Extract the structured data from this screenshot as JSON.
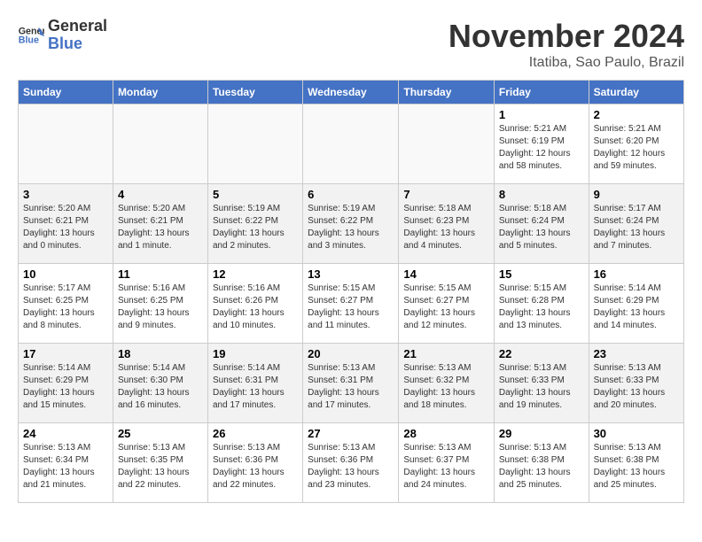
{
  "header": {
    "logo_general": "General",
    "logo_blue": "Blue",
    "month_year": "November 2024",
    "location": "Itatiba, Sao Paulo, Brazil"
  },
  "days_of_week": [
    "Sunday",
    "Monday",
    "Tuesday",
    "Wednesday",
    "Thursday",
    "Friday",
    "Saturday"
  ],
  "weeks": [
    {
      "days": [
        {
          "num": "",
          "info": ""
        },
        {
          "num": "",
          "info": ""
        },
        {
          "num": "",
          "info": ""
        },
        {
          "num": "",
          "info": ""
        },
        {
          "num": "",
          "info": ""
        },
        {
          "num": "1",
          "info": "Sunrise: 5:21 AM\nSunset: 6:19 PM\nDaylight: 12 hours and 58 minutes."
        },
        {
          "num": "2",
          "info": "Sunrise: 5:21 AM\nSunset: 6:20 PM\nDaylight: 12 hours and 59 minutes."
        }
      ]
    },
    {
      "days": [
        {
          "num": "3",
          "info": "Sunrise: 5:20 AM\nSunset: 6:21 PM\nDaylight: 13 hours and 0 minutes."
        },
        {
          "num": "4",
          "info": "Sunrise: 5:20 AM\nSunset: 6:21 PM\nDaylight: 13 hours and 1 minute."
        },
        {
          "num": "5",
          "info": "Sunrise: 5:19 AM\nSunset: 6:22 PM\nDaylight: 13 hours and 2 minutes."
        },
        {
          "num": "6",
          "info": "Sunrise: 5:19 AM\nSunset: 6:22 PM\nDaylight: 13 hours and 3 minutes."
        },
        {
          "num": "7",
          "info": "Sunrise: 5:18 AM\nSunset: 6:23 PM\nDaylight: 13 hours and 4 minutes."
        },
        {
          "num": "8",
          "info": "Sunrise: 5:18 AM\nSunset: 6:24 PM\nDaylight: 13 hours and 5 minutes."
        },
        {
          "num": "9",
          "info": "Sunrise: 5:17 AM\nSunset: 6:24 PM\nDaylight: 13 hours and 7 minutes."
        }
      ]
    },
    {
      "days": [
        {
          "num": "10",
          "info": "Sunrise: 5:17 AM\nSunset: 6:25 PM\nDaylight: 13 hours and 8 minutes."
        },
        {
          "num": "11",
          "info": "Sunrise: 5:16 AM\nSunset: 6:25 PM\nDaylight: 13 hours and 9 minutes."
        },
        {
          "num": "12",
          "info": "Sunrise: 5:16 AM\nSunset: 6:26 PM\nDaylight: 13 hours and 10 minutes."
        },
        {
          "num": "13",
          "info": "Sunrise: 5:15 AM\nSunset: 6:27 PM\nDaylight: 13 hours and 11 minutes."
        },
        {
          "num": "14",
          "info": "Sunrise: 5:15 AM\nSunset: 6:27 PM\nDaylight: 13 hours and 12 minutes."
        },
        {
          "num": "15",
          "info": "Sunrise: 5:15 AM\nSunset: 6:28 PM\nDaylight: 13 hours and 13 minutes."
        },
        {
          "num": "16",
          "info": "Sunrise: 5:14 AM\nSunset: 6:29 PM\nDaylight: 13 hours and 14 minutes."
        }
      ]
    },
    {
      "days": [
        {
          "num": "17",
          "info": "Sunrise: 5:14 AM\nSunset: 6:29 PM\nDaylight: 13 hours and 15 minutes."
        },
        {
          "num": "18",
          "info": "Sunrise: 5:14 AM\nSunset: 6:30 PM\nDaylight: 13 hours and 16 minutes."
        },
        {
          "num": "19",
          "info": "Sunrise: 5:14 AM\nSunset: 6:31 PM\nDaylight: 13 hours and 17 minutes."
        },
        {
          "num": "20",
          "info": "Sunrise: 5:13 AM\nSunset: 6:31 PM\nDaylight: 13 hours and 17 minutes."
        },
        {
          "num": "21",
          "info": "Sunrise: 5:13 AM\nSunset: 6:32 PM\nDaylight: 13 hours and 18 minutes."
        },
        {
          "num": "22",
          "info": "Sunrise: 5:13 AM\nSunset: 6:33 PM\nDaylight: 13 hours and 19 minutes."
        },
        {
          "num": "23",
          "info": "Sunrise: 5:13 AM\nSunset: 6:33 PM\nDaylight: 13 hours and 20 minutes."
        }
      ]
    },
    {
      "days": [
        {
          "num": "24",
          "info": "Sunrise: 5:13 AM\nSunset: 6:34 PM\nDaylight: 13 hours and 21 minutes."
        },
        {
          "num": "25",
          "info": "Sunrise: 5:13 AM\nSunset: 6:35 PM\nDaylight: 13 hours and 22 minutes."
        },
        {
          "num": "26",
          "info": "Sunrise: 5:13 AM\nSunset: 6:36 PM\nDaylight: 13 hours and 22 minutes."
        },
        {
          "num": "27",
          "info": "Sunrise: 5:13 AM\nSunset: 6:36 PM\nDaylight: 13 hours and 23 minutes."
        },
        {
          "num": "28",
          "info": "Sunrise: 5:13 AM\nSunset: 6:37 PM\nDaylight: 13 hours and 24 minutes."
        },
        {
          "num": "29",
          "info": "Sunrise: 5:13 AM\nSunset: 6:38 PM\nDaylight: 13 hours and 25 minutes."
        },
        {
          "num": "30",
          "info": "Sunrise: 5:13 AM\nSunset: 6:38 PM\nDaylight: 13 hours and 25 minutes."
        }
      ]
    }
  ]
}
